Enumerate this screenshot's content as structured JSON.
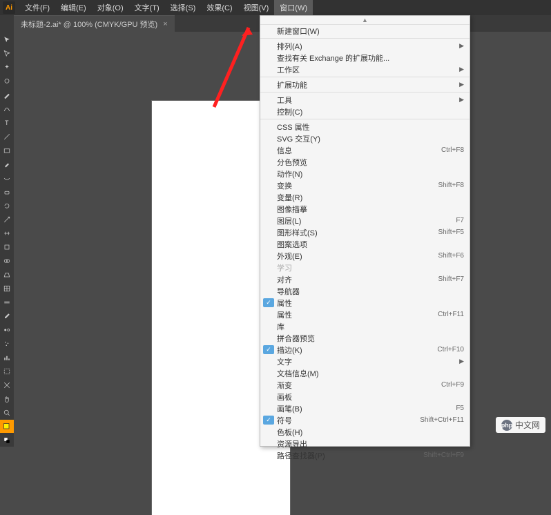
{
  "app_icon": "Ai",
  "menubar": [
    {
      "label": "文件(F)"
    },
    {
      "label": "编辑(E)"
    },
    {
      "label": "对象(O)"
    },
    {
      "label": "文字(T)"
    },
    {
      "label": "选择(S)"
    },
    {
      "label": "效果(C)"
    },
    {
      "label": "视图(V)"
    },
    {
      "label": "窗口(W)",
      "active": true
    }
  ],
  "tab": {
    "title": "未标题-2.ai* @ 100% (CMYK/GPU 预览)",
    "close": "×"
  },
  "dropdown": {
    "scroll_up": "▲",
    "items": [
      {
        "label": "新建窗口(W)"
      },
      {
        "sep": true
      },
      {
        "label": "排列(A)",
        "submenu": true
      },
      {
        "label": "查找有关 Exchange 的扩展功能..."
      },
      {
        "label": "工作区",
        "submenu": true
      },
      {
        "sep": true
      },
      {
        "label": "扩展功能",
        "submenu": true
      },
      {
        "sep": true
      },
      {
        "label": "工具",
        "submenu": true
      },
      {
        "label": "控制(C)"
      },
      {
        "sep": true
      },
      {
        "label": "CSS 属性"
      },
      {
        "label": "SVG 交互(Y)"
      },
      {
        "label": "信息",
        "shortcut": "Ctrl+F8"
      },
      {
        "label": "分色预览"
      },
      {
        "label": "动作(N)"
      },
      {
        "label": "变换",
        "shortcut": "Shift+F8"
      },
      {
        "label": "变量(R)"
      },
      {
        "label": "图像描摹"
      },
      {
        "label": "图层(L)",
        "shortcut": "F7"
      },
      {
        "label": "图形样式(S)",
        "shortcut": "Shift+F5"
      },
      {
        "label": "图案选项"
      },
      {
        "label": "外观(E)",
        "shortcut": "Shift+F6"
      },
      {
        "label": "学习",
        "disabled": true
      },
      {
        "label": "对齐",
        "shortcut": "Shift+F7"
      },
      {
        "label": "导航器"
      },
      {
        "label": "属性",
        "checked": true
      },
      {
        "label": "属性",
        "shortcut": "Ctrl+F11"
      },
      {
        "label": "库"
      },
      {
        "label": "拼合器预览"
      },
      {
        "label": "描边(K)",
        "shortcut": "Ctrl+F10",
        "checked": true
      },
      {
        "label": "文字",
        "submenu": true
      },
      {
        "label": "文档信息(M)"
      },
      {
        "label": "渐变",
        "shortcut": "Ctrl+F9"
      },
      {
        "label": "画板"
      },
      {
        "label": "画笔(B)",
        "shortcut": "F5"
      },
      {
        "label": "符号",
        "shortcut": "Shift+Ctrl+F11",
        "checked": true
      },
      {
        "label": "色板(H)"
      },
      {
        "label": "资源导出"
      },
      {
        "label": "路径查找器(P)",
        "shortcut": "Shift+Ctrl+F9"
      }
    ]
  },
  "watermark": {
    "logo": "php",
    "text": "中文网"
  }
}
